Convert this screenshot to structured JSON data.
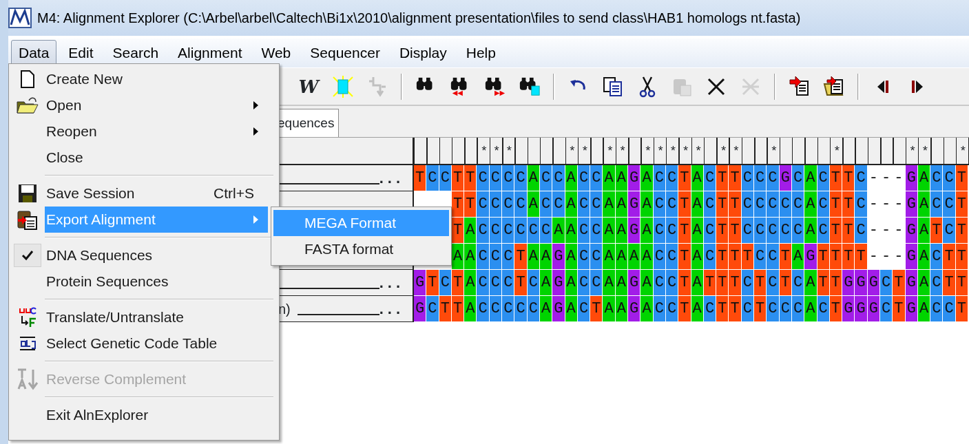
{
  "window": {
    "title": "M4: Alignment Explorer (C:\\Arbel\\arbel\\Caltech\\Bi1x\\2010\\alignment presentation\\files to send class\\HAB1 homologs nt.fasta)"
  },
  "menubar": [
    {
      "label": "Data",
      "selected": true
    },
    {
      "label": "Edit",
      "selected": false
    },
    {
      "label": "Search",
      "selected": false
    },
    {
      "label": "Alignment",
      "selected": false
    },
    {
      "label": "Web",
      "selected": false
    },
    {
      "label": "Sequencer",
      "selected": false
    },
    {
      "label": "Display",
      "selected": false
    },
    {
      "label": "Help",
      "selected": false
    }
  ],
  "toolbar": [
    {
      "kind": "bold-w",
      "label": "W",
      "disabled": false
    },
    {
      "kind": "highlight",
      "disabled": false
    },
    {
      "kind": "insert",
      "disabled": true
    },
    {
      "kind": "separator"
    },
    {
      "kind": "find",
      "disabled": false
    },
    {
      "kind": "find-previous",
      "disabled": false
    },
    {
      "kind": "find-next",
      "disabled": false
    },
    {
      "kind": "find-highlight",
      "disabled": false
    },
    {
      "kind": "separator"
    },
    {
      "kind": "undo",
      "disabled": false
    },
    {
      "kind": "copy",
      "disabled": false
    },
    {
      "kind": "cut",
      "disabled": false
    },
    {
      "kind": "paste",
      "disabled": true
    },
    {
      "kind": "delete",
      "disabled": false
    },
    {
      "kind": "delete-gaps",
      "disabled": true
    },
    {
      "kind": "separator"
    },
    {
      "kind": "export",
      "disabled": false
    },
    {
      "kind": "export-doc",
      "disabled": false
    },
    {
      "kind": "separator"
    },
    {
      "kind": "previous",
      "disabled": false
    },
    {
      "kind": "next",
      "disabled": false
    }
  ],
  "tabs": [
    {
      "label": "equences",
      "selected": true
    }
  ],
  "alignment": {
    "consensus": "     ***    ** ** ***** **  *    *     **  *",
    "rows": [
      {
        "ellipsis": "...",
        "sequence": "TCCTTCCCCACCACCAAGACCTACTTCCCGCACTTC---GACCT"
      },
      {
        "sequence": "   TTCCCCACCACCAAGACCTACTTCCCCCACTTC---GACCT"
      },
      {
        "sequence": "   TACCCCCCAACCAAGACCTACTTCCCCCACTTC---GATCT"
      },
      {
        "sequence": "   AACCCTAAGACCAAAACCTACTTTCCTAGTTTT---GACTT"
      },
      {
        "ellipsis": "...",
        "sequence": "GTCTACCCTCAGACCAAGACCTATTTCTCTCATTGGGCTGACTT"
      },
      {
        "name_fragment": "n)",
        "ellipsis": "...",
        "sequence": "GCTTACCCCCAGACTAAGACCTACTTCTCCCACTGGGCTGACCT"
      }
    ]
  },
  "data_menu": {
    "items": [
      {
        "kind": "item",
        "label": "Create New",
        "submenu": false,
        "selected": false,
        "disabled": false,
        "checked": false
      },
      {
        "kind": "item",
        "label": "Open",
        "submenu": true,
        "selected": false,
        "disabled": false,
        "checked": false
      },
      {
        "kind": "item",
        "label": "Reopen",
        "submenu": true,
        "selected": false,
        "disabled": false,
        "checked": false
      },
      {
        "kind": "item",
        "label": "Close",
        "submenu": false,
        "selected": false,
        "disabled": false,
        "checked": false
      },
      {
        "kind": "separator"
      },
      {
        "kind": "item",
        "label": "Save Session",
        "shortcut": "Ctrl+S",
        "submenu": false,
        "selected": false,
        "disabled": false,
        "checked": false
      },
      {
        "kind": "item",
        "label": "Export Alignment",
        "submenu": true,
        "selected": true,
        "disabled": false,
        "checked": false
      },
      {
        "kind": "separator"
      },
      {
        "kind": "item",
        "label": "DNA Sequences",
        "submenu": false,
        "selected": false,
        "disabled": false,
        "checked": true
      },
      {
        "kind": "item",
        "label": "Protein Sequences",
        "submenu": false,
        "selected": false,
        "disabled": false,
        "checked": false
      },
      {
        "kind": "separator"
      },
      {
        "kind": "item",
        "label": "Translate/Untranslate",
        "submenu": false,
        "selected": false,
        "disabled": false,
        "checked": false
      },
      {
        "kind": "item",
        "label": "Select Genetic Code Table",
        "submenu": false,
        "selected": false,
        "disabled": false,
        "checked": false
      },
      {
        "kind": "separator"
      },
      {
        "kind": "item",
        "label": "Reverse Complement",
        "submenu": false,
        "selected": false,
        "disabled": true,
        "checked": false
      },
      {
        "kind": "separator"
      },
      {
        "kind": "item",
        "label": "Exit AlnExplorer",
        "submenu": false,
        "selected": false,
        "disabled": false,
        "checked": false
      }
    ]
  },
  "export_submenu": {
    "items": [
      {
        "label": "MEGA Format",
        "selected": true
      },
      {
        "label": "FASTA format",
        "selected": false
      }
    ]
  }
}
